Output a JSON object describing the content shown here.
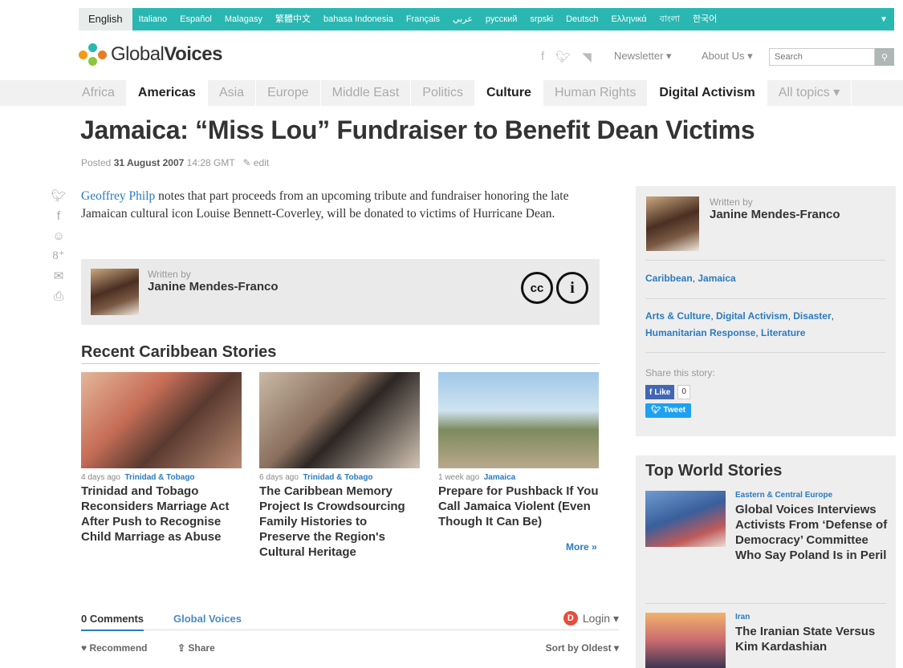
{
  "languages": {
    "active": "English",
    "items": [
      "Italiano",
      "Español",
      "Malagasy",
      "繁體中文",
      "bahasa Indonesia",
      "Français",
      "عربي",
      "русский",
      "srpski",
      "Deutsch",
      "Ελληνικά",
      "বাংলা",
      "한국어"
    ]
  },
  "header": {
    "logo_a": "Global",
    "logo_b": "Voices",
    "newsletter": "Newsletter ▾",
    "about": "About Us ▾",
    "search_placeholder": "Search"
  },
  "nav": {
    "items": [
      "Africa",
      "Americas",
      "Asia",
      "Europe",
      "Middle East",
      "Politics",
      "Culture",
      "Human Rights",
      "Digital Activism",
      "All topics ▾"
    ],
    "selected": [
      "Americas",
      "Culture",
      "Digital Activism"
    ]
  },
  "article": {
    "title": "Jamaica: “Miss Lou” Fundraiser to Benefit Dean Victims",
    "posted_label": "Posted",
    "date": "31 August 2007",
    "time": "14:28 GMT",
    "edit": "edit",
    "body_link": "Geoffrey Philp",
    "body_rest": " notes that part proceeds from an upcoming tribute and fundraiser honoring the late Jamaican cultural icon Louise Bennett-Coverley, will be donated to victims of Hurricane Dean.",
    "written_by": "Written by",
    "author": "Janine Mendes-Franco",
    "cc_a": "cc",
    "cc_b": "i"
  },
  "recent": {
    "heading": "Recent Caribbean Stories",
    "stories": [
      {
        "ago": "4 days ago",
        "cat": "Trinidad & Tobago",
        "title": "Trinidad and Tobago Reconsiders Marriage Act After Push to Recognise Child Marriage as Abuse"
      },
      {
        "ago": "6 days ago",
        "cat": "Trinidad & Tobago",
        "title": "The Caribbean Memory Project Is Crowdsourcing Family Histories to Preserve the Region's Cultural Heritage"
      },
      {
        "ago": "1 week ago",
        "cat": "Jamaica",
        "title": "Prepare for Pushback If You Call Jamaica Violent (Even Though It Can Be)"
      }
    ],
    "more": "More »"
  },
  "comments": {
    "count": "0 Comments",
    "site": "Global Voices",
    "login": "Login ▾",
    "recommend": "Recommend",
    "share": "Share",
    "sort": "Sort by Oldest ▾"
  },
  "sidebar": {
    "written_by": "Written by",
    "author": "Janine Mendes-Franco",
    "regions": [
      "Caribbean",
      "Jamaica"
    ],
    "topics": [
      "Arts & Culture",
      "Digital Activism",
      "Disaster",
      "Humanitarian Response",
      "Literature"
    ],
    "share_label": "Share this story:",
    "like": "Like",
    "like_count": "0",
    "tweet": "Tweet"
  },
  "top_world": {
    "heading": "Top World Stories",
    "items": [
      {
        "cat": "Eastern & Central Europe",
        "title": "Global Voices Interviews Activists From ‘Defense of Democracy’ Committee Who Say Poland Is in Peril"
      },
      {
        "cat": "Iran",
        "title": "The Iranian State Versus Kim Kardashian"
      }
    ]
  },
  "colors": {
    "teal": "#2ab7b2",
    "link_blue": "#2a7bc0"
  }
}
